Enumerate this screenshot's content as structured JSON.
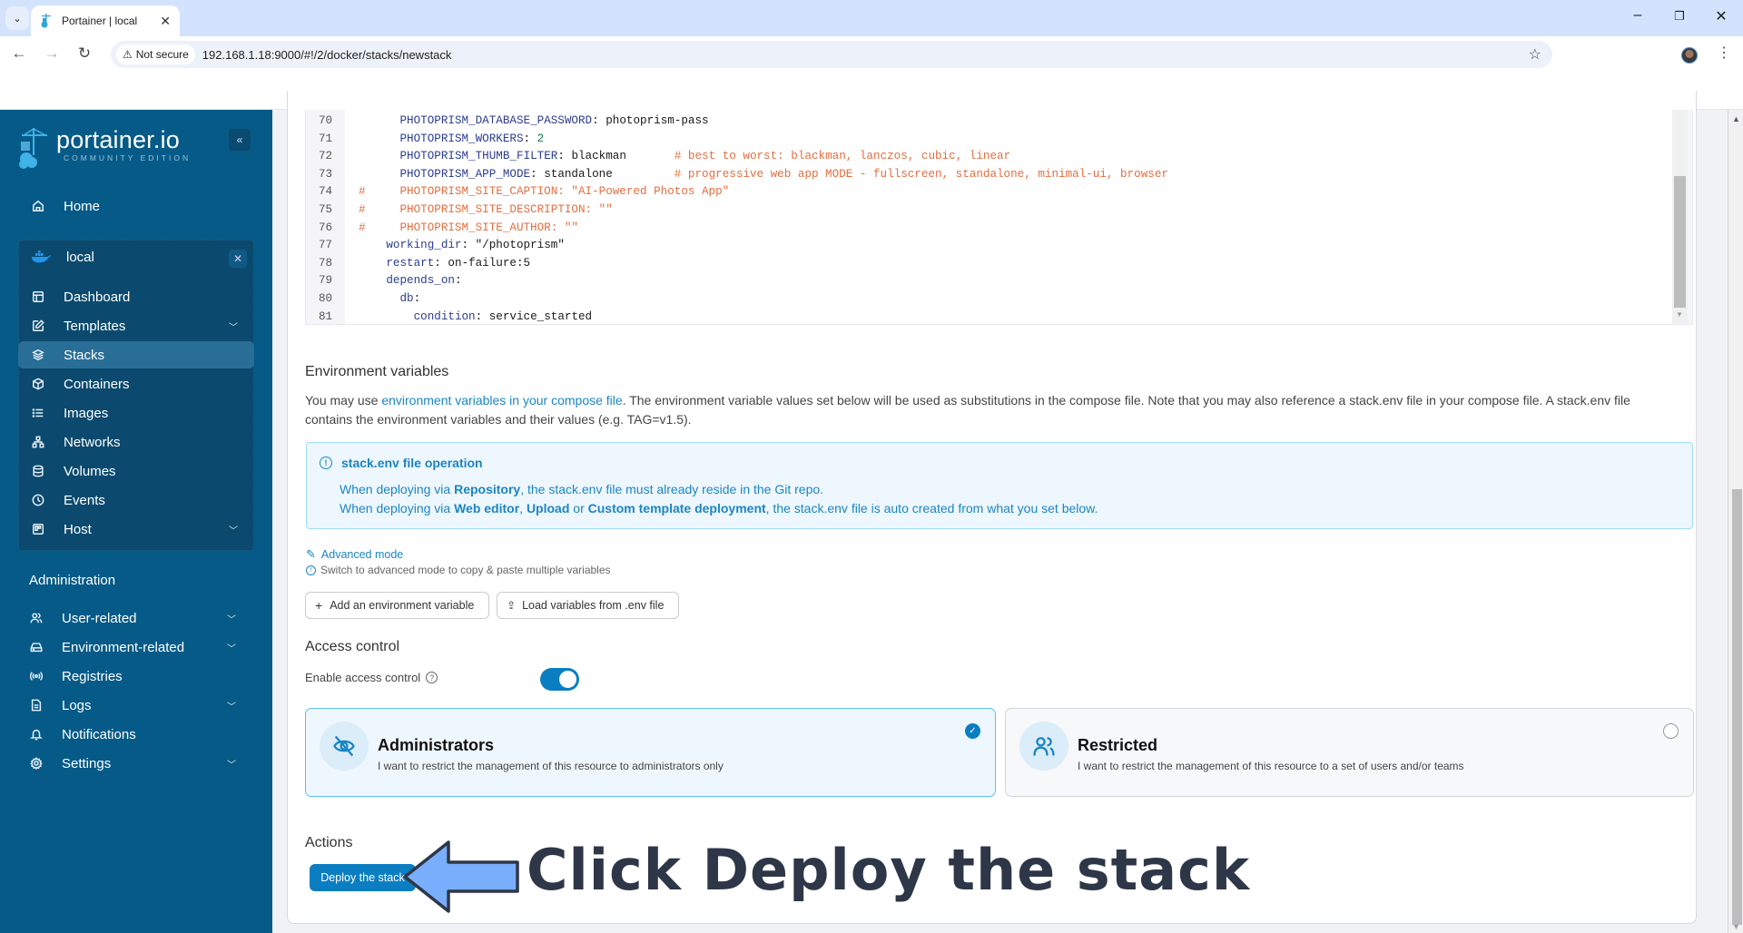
{
  "browser": {
    "tab_title": "Portainer | local",
    "not_secure_label": "Not secure",
    "url": "192.168.1.18:9000/#!/2/docker/stacks/newstack"
  },
  "sidebar": {
    "logo_main": "portainer.io",
    "logo_sub": "COMMUNITY EDITION",
    "home": "Home",
    "environment": "local",
    "env_items": [
      {
        "label": "Dashboard",
        "icon": "dashboard-icon"
      },
      {
        "label": "Templates",
        "icon": "edit-icon",
        "expandable": true
      },
      {
        "label": "Stacks",
        "icon": "layers-icon",
        "active": true
      },
      {
        "label": "Containers",
        "icon": "box-icon"
      },
      {
        "label": "Images",
        "icon": "list-icon"
      },
      {
        "label": "Networks",
        "icon": "network-icon"
      },
      {
        "label": "Volumes",
        "icon": "database-icon"
      },
      {
        "label": "Events",
        "icon": "clock-icon"
      },
      {
        "label": "Host",
        "icon": "host-icon",
        "expandable": true
      }
    ],
    "admin_heading": "Administration",
    "admin_items": [
      {
        "label": "User-related",
        "icon": "users-icon",
        "expandable": true
      },
      {
        "label": "Environment-related",
        "icon": "drive-icon",
        "expandable": true
      },
      {
        "label": "Registries",
        "icon": "radio-icon"
      },
      {
        "label": "Logs",
        "icon": "file-icon",
        "expandable": true
      },
      {
        "label": "Notifications",
        "icon": "bell-icon"
      },
      {
        "label": "Settings",
        "icon": "gear-icon",
        "expandable": true
      }
    ]
  },
  "editor": {
    "lines": [
      {
        "n": "70",
        "indent": "      ",
        "key": "PHOTOPRISM_DATABASE_PASSWORD",
        "val": "photoprism-pass",
        "comment": ""
      },
      {
        "n": "71",
        "indent": "      ",
        "key": "PHOTOPRISM_WORKERS",
        "val": "2",
        "num": true,
        "comment": ""
      },
      {
        "n": "72",
        "indent": "      ",
        "key": "PHOTOPRISM_THUMB_FILTER",
        "val": "blackman       ",
        "comment": "# best to worst: blackman, lanczos, cubic, linear"
      },
      {
        "n": "73",
        "indent": "      ",
        "key": "PHOTOPRISM_APP_MODE",
        "val": "standalone         ",
        "comment": "# progressive web app MODE - fullscreen, standalone, minimal-ui, browser"
      },
      {
        "n": "74",
        "full_comment": "#     PHOTOPRISM_SITE_CAPTION: \"AI-Powered Photos App\""
      },
      {
        "n": "75",
        "full_comment": "#     PHOTOPRISM_SITE_DESCRIPTION: \"\""
      },
      {
        "n": "76",
        "full_comment": "#     PHOTOPRISM_SITE_AUTHOR: \"\""
      },
      {
        "n": "77",
        "indent": "    ",
        "key": "working_dir",
        "val": "\"/photoprism\"",
        "comment": ""
      },
      {
        "n": "78",
        "indent": "    ",
        "key": "restart",
        "val": "on-failure:5",
        "comment": ""
      },
      {
        "n": "79",
        "indent": "    ",
        "key": "depends_on",
        "val": "",
        "comment": ""
      },
      {
        "n": "80",
        "indent": "      ",
        "key": "db",
        "val": "",
        "comment": ""
      },
      {
        "n": "81",
        "indent": "        ",
        "key": "condition",
        "val": "service_started",
        "comment": ""
      }
    ]
  },
  "env_vars": {
    "heading": "Environment variables",
    "desc_prefix": "You may use ",
    "desc_link": "environment variables in your compose file",
    "desc_suffix": ". The environment variable values set below will be used as substitutions in the compose file. Note that you may also reference a stack.env file in your compose file. A stack.env file contains the environment variables and their values (e.g. TAG=v1.5).",
    "info_title": "stack.env file operation",
    "info_line1": {
      "a": "When deploying via ",
      "b": "Repository",
      "c": ", the stack.env file must already reside in the Git repo."
    },
    "info_line2": {
      "a": "When deploying via ",
      "b": "Web editor",
      "c": ", ",
      "d": "Upload",
      "e": " or ",
      "f": "Custom template deployment",
      "g": ", the stack.env file is auto created from what you set below."
    },
    "advanced_mode": "Advanced mode",
    "advanced_hint": "Switch to advanced mode to copy & paste multiple variables",
    "add_button": "Add an environment variable",
    "load_button": "Load variables from .env file"
  },
  "access_control": {
    "heading": "Access control",
    "enable_label": "Enable access control",
    "enabled": true,
    "options": [
      {
        "title": "Administrators",
        "desc": "I want to restrict the management of this resource to administrators only",
        "selected": true
      },
      {
        "title": "Restricted",
        "desc": "I want to restrict the management of this resource to a set of users and/or teams",
        "selected": false
      }
    ]
  },
  "actions": {
    "heading": "Actions",
    "deploy_button": "Deploy the stack"
  },
  "annotation": {
    "text": "Click Deploy the stack"
  }
}
